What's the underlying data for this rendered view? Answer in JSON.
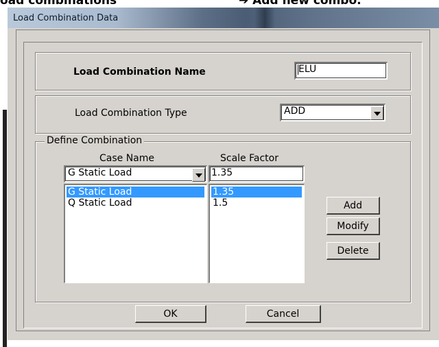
{
  "background": {
    "heading_left": "oad combinations",
    "heading_right": "➔ Add new combo."
  },
  "window": {
    "title": "Load Combination Data"
  },
  "combo_name": {
    "label": "Load Combination Name",
    "value": "ELU"
  },
  "combo_type": {
    "label": "Load Combination Type",
    "selected": "ADD"
  },
  "define": {
    "legend": "Define Combination",
    "case_name_header": "Case Name",
    "scale_factor_header": "Scale Factor",
    "case_select_value": "G Static Load",
    "scale_input_value": "1.35",
    "rows": [
      {
        "case": "G Static Load",
        "factor": "1.35",
        "selected": true
      },
      {
        "case": "Q Static Load",
        "factor": "1.5",
        "selected": false
      }
    ],
    "add_label": "Add",
    "modify_label": "Modify",
    "delete_label": "Delete"
  },
  "footer": {
    "ok_label": "OK",
    "cancel_label": "Cancel"
  },
  "colors": {
    "dialog_bg": "#d6d3ce",
    "selection": "#3399ff"
  }
}
